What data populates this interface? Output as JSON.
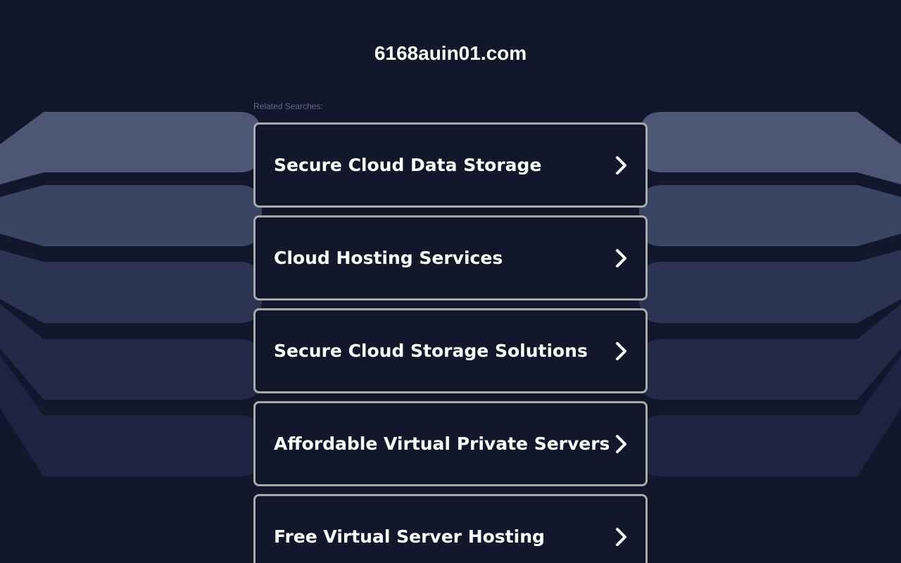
{
  "site": {
    "domain": "6168auin01.com"
  },
  "related": {
    "label": "Related Searches:",
    "items": [
      {
        "label": "Secure Cloud Data Storage",
        "icon": "chevron-right-icon"
      },
      {
        "label": "Cloud Hosting Services",
        "icon": "chevron-right-icon"
      },
      {
        "label": "Secure Cloud Storage Solutions",
        "icon": "chevron-right-icon"
      },
      {
        "label": "Affordable Virtual Private Servers",
        "icon": "chevron-right-icon"
      },
      {
        "label": "Free Virtual Server Hosting",
        "icon": "chevron-right-icon"
      }
    ]
  },
  "colors": {
    "background": "#12172b",
    "card_border": "#a9a9a9",
    "text": "#ffffff",
    "label_muted": "#5f6a8a"
  }
}
